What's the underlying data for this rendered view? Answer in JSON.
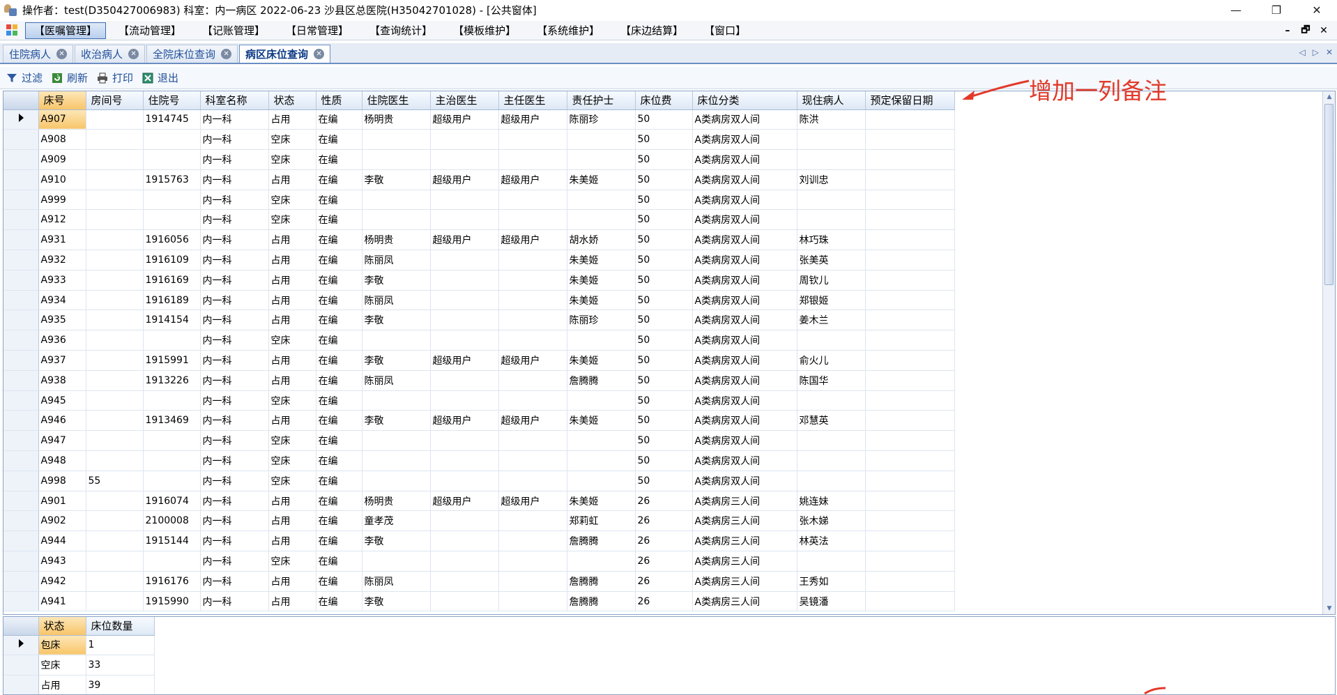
{
  "window": {
    "title": "操作者：test(D350427006983)  科室：内一病区  2022-06-23  沙县区总医院(H35042701028) - [公共窗体]",
    "controls": [
      "—",
      "❐",
      "✕"
    ]
  },
  "menu": {
    "items": [
      "【医嘱管理】",
      "【流动管理】",
      "【记账管理】",
      "【日常管理】",
      "【查询统计】",
      "【模板维护】",
      "【系统维护】",
      "【床边结算】",
      "【窗口】"
    ],
    "active_index": 0,
    "mdi_controls": [
      "–",
      "🗗",
      "✕"
    ]
  },
  "tabs": [
    {
      "label": "住院病人",
      "active": false
    },
    {
      "label": "收治病人",
      "active": false
    },
    {
      "label": "全院床位查询",
      "active": false
    },
    {
      "label": "病区床位查询",
      "active": true
    }
  ],
  "tab_nav": [
    "◁",
    "▷",
    "✕"
  ],
  "toolbar": {
    "items": [
      {
        "label": "过滤",
        "icon": "filter-icon"
      },
      {
        "label": "刷新",
        "icon": "refresh-icon"
      },
      {
        "label": "打印",
        "icon": "print-icon"
      },
      {
        "label": "退出",
        "icon": "exit-icon"
      }
    ]
  },
  "grid": {
    "columns": [
      "床号",
      "房间号",
      "住院号",
      "科室名称",
      "状态",
      "性质",
      "住院医生",
      "主治医生",
      "主任医生",
      "责任护士",
      "床位费",
      "床位分类",
      "现住病人",
      "预定保留日期"
    ],
    "rows": [
      [
        "A907",
        "",
        "1914745",
        "内一科",
        "占用",
        "在编",
        "杨明贵",
        "超级用户",
        "超级用户",
        "陈丽珍",
        "50",
        "A类病房双人间",
        "陈洪",
        ""
      ],
      [
        "A908",
        "",
        "",
        "内一科",
        "空床",
        "在编",
        "",
        "",
        "",
        "",
        "50",
        "A类病房双人间",
        "",
        ""
      ],
      [
        "A909",
        "",
        "",
        "内一科",
        "空床",
        "在编",
        "",
        "",
        "",
        "",
        "50",
        "A类病房双人间",
        "",
        ""
      ],
      [
        "A910",
        "",
        "1915763",
        "内一科",
        "占用",
        "在编",
        "李敬",
        "超级用户",
        "超级用户",
        "朱美姬",
        "50",
        "A类病房双人间",
        "刘训忠",
        ""
      ],
      [
        "A999",
        "",
        "",
        "内一科",
        "空床",
        "在编",
        "",
        "",
        "",
        "",
        "50",
        "A类病房双人间",
        "",
        ""
      ],
      [
        "A912",
        "",
        "",
        "内一科",
        "空床",
        "在编",
        "",
        "",
        "",
        "",
        "50",
        "A类病房双人间",
        "",
        ""
      ],
      [
        "A931",
        "",
        "1916056",
        "内一科",
        "占用",
        "在编",
        "杨明贵",
        "超级用户",
        "超级用户",
        "胡水娇",
        "50",
        "A类病房双人间",
        "林巧珠",
        ""
      ],
      [
        "A932",
        "",
        "1916109",
        "内一科",
        "占用",
        "在编",
        "陈丽凤",
        "",
        "",
        "朱美姬",
        "50",
        "A类病房双人间",
        "张美英",
        ""
      ],
      [
        "A933",
        "",
        "1916169",
        "内一科",
        "占用",
        "在编",
        "李敬",
        "",
        "",
        "朱美姬",
        "50",
        "A类病房双人间",
        "周钦儿",
        ""
      ],
      [
        "A934",
        "",
        "1916189",
        "内一科",
        "占用",
        "在编",
        "陈丽凤",
        "",
        "",
        "朱美姬",
        "50",
        "A类病房双人间",
        "郑银姬",
        ""
      ],
      [
        "A935",
        "",
        "1914154",
        "内一科",
        "占用",
        "在编",
        "李敬",
        "",
        "",
        "陈丽珍",
        "50",
        "A类病房双人间",
        "姜木兰",
        ""
      ],
      [
        "A936",
        "",
        "",
        "内一科",
        "空床",
        "在编",
        "",
        "",
        "",
        "",
        "50",
        "A类病房双人间",
        "",
        ""
      ],
      [
        "A937",
        "",
        "1915991",
        "内一科",
        "占用",
        "在编",
        "李敬",
        "超级用户",
        "超级用户",
        "朱美姬",
        "50",
        "A类病房双人间",
        "俞火儿",
        ""
      ],
      [
        "A938",
        "",
        "1913226",
        "内一科",
        "占用",
        "在编",
        "陈丽凤",
        "",
        "",
        "詹腾腾",
        "50",
        "A类病房双人间",
        "陈国华",
        ""
      ],
      [
        "A945",
        "",
        "",
        "内一科",
        "空床",
        "在编",
        "",
        "",
        "",
        "",
        "50",
        "A类病房双人间",
        "",
        ""
      ],
      [
        "A946",
        "",
        "1913469",
        "内一科",
        "占用",
        "在编",
        "李敬",
        "超级用户",
        "超级用户",
        "朱美姬",
        "50",
        "A类病房双人间",
        "邓慧英",
        ""
      ],
      [
        "A947",
        "",
        "",
        "内一科",
        "空床",
        "在编",
        "",
        "",
        "",
        "",
        "50",
        "A类病房双人间",
        "",
        ""
      ],
      [
        "A948",
        "",
        "",
        "内一科",
        "空床",
        "在编",
        "",
        "",
        "",
        "",
        "50",
        "A类病房双人间",
        "",
        ""
      ],
      [
        "A998",
        "55",
        "",
        "内一科",
        "空床",
        "在编",
        "",
        "",
        "",
        "",
        "50",
        "A类病房双人间",
        "",
        ""
      ],
      [
        "A901",
        "",
        "1916074",
        "内一科",
        "占用",
        "在编",
        "杨明贵",
        "超级用户",
        "超级用户",
        "朱美姬",
        "26",
        "A类病房三人间",
        "姚连妹",
        ""
      ],
      [
        "A902",
        "",
        "2100008",
        "内一科",
        "占用",
        "在编",
        "童孝茂",
        "",
        "",
        "郑莉虹",
        "26",
        "A类病房三人间",
        "张木娣",
        ""
      ],
      [
        "A944",
        "",
        "1915144",
        "内一科",
        "占用",
        "在编",
        "李敬",
        "",
        "",
        "詹腾腾",
        "26",
        "A类病房三人间",
        "林英法",
        ""
      ],
      [
        "A943",
        "",
        "",
        "内一科",
        "空床",
        "在编",
        "",
        "",
        "",
        "",
        "26",
        "A类病房三人间",
        "",
        ""
      ],
      [
        "A942",
        "",
        "1916176",
        "内一科",
        "占用",
        "在编",
        "陈丽凤",
        "",
        "",
        "詹腾腾",
        "26",
        "A类病房三人间",
        "王秀如",
        ""
      ],
      [
        "A941",
        "",
        "1915990",
        "内一科",
        "占用",
        "在编",
        "李敬",
        "",
        "",
        "詹腾腾",
        "26",
        "A类病房三人间",
        "吴镜潘",
        ""
      ]
    ]
  },
  "summary": {
    "columns": [
      "状态",
      "床位数量"
    ],
    "rows": [
      [
        "包床",
        "1"
      ],
      [
        "空床",
        "33"
      ],
      [
        "占用",
        "39"
      ]
    ]
  },
  "annotation": {
    "text": "增加一列备注",
    "color": "#e23a2a"
  },
  "colors": {
    "accent": "#3e6db0",
    "selected": "#f8c56b",
    "grid_border": "#8aa3c8"
  }
}
